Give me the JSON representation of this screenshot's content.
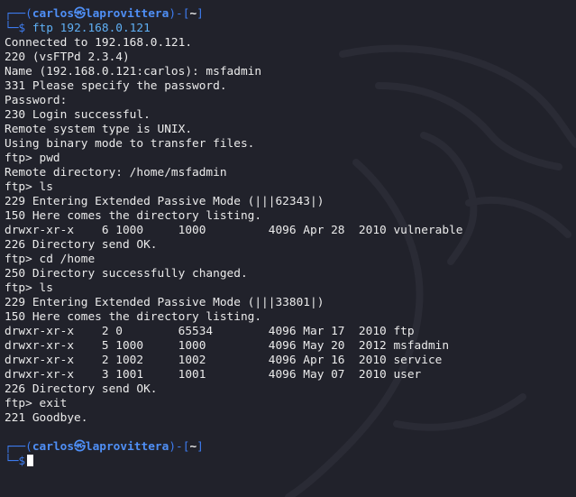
{
  "session1": {
    "prompt": {
      "open": "┌──(",
      "user": "carlos",
      "at": "㉿",
      "host": "laprovittera",
      "mid": ")-[",
      "cwd": "~",
      "close": "]",
      "lead": "└─",
      "dollar": "$ "
    },
    "command": "ftp 192.168.0.121"
  },
  "output": [
    "Connected to 192.168.0.121.",
    "220 (vsFTPd 2.3.4)",
    "Name (192.168.0.121:carlos): msfadmin",
    "331 Please specify the password.",
    "Password:",
    "230 Login successful.",
    "Remote system type is UNIX.",
    "Using binary mode to transfer files.",
    "ftp> pwd",
    "Remote directory: /home/msfadmin",
    "ftp> ls",
    "229 Entering Extended Passive Mode (|||62343|)",
    "150 Here comes the directory listing.",
    "drwxr-xr-x    6 1000     1000         4096 Apr 28  2010 vulnerable",
    "226 Directory send OK.",
    "ftp> cd /home",
    "250 Directory successfully changed.",
    "ftp> ls",
    "229 Entering Extended Passive Mode (|||33801|)",
    "150 Here comes the directory listing.",
    "drwxr-xr-x    2 0        65534        4096 Mar 17  2010 ftp",
    "drwxr-xr-x    5 1000     1000         4096 May 20  2012 msfadmin",
    "drwxr-xr-x    2 1002     1002         4096 Apr 16  2010 service",
    "drwxr-xr-x    3 1001     1001         4096 May 07  2010 user",
    "226 Directory send OK.",
    "ftp> exit",
    "221 Goodbye."
  ],
  "session2": {
    "prompt": {
      "open": "┌──(",
      "user": "carlos",
      "at": "㉿",
      "host": "laprovittera",
      "mid": ")-[",
      "cwd": "~",
      "close": "]",
      "lead": "└─",
      "dollar": "$"
    }
  },
  "colors": {
    "background": "#21222b",
    "text": "#ebebeb",
    "prompt_frame": "#3d7cf0",
    "prompt_user": "#4f8ff6",
    "command": "#5fb0f5",
    "cursor": "#ffffff"
  },
  "icons": {
    "watermark": "kali-dragon-icon"
  }
}
